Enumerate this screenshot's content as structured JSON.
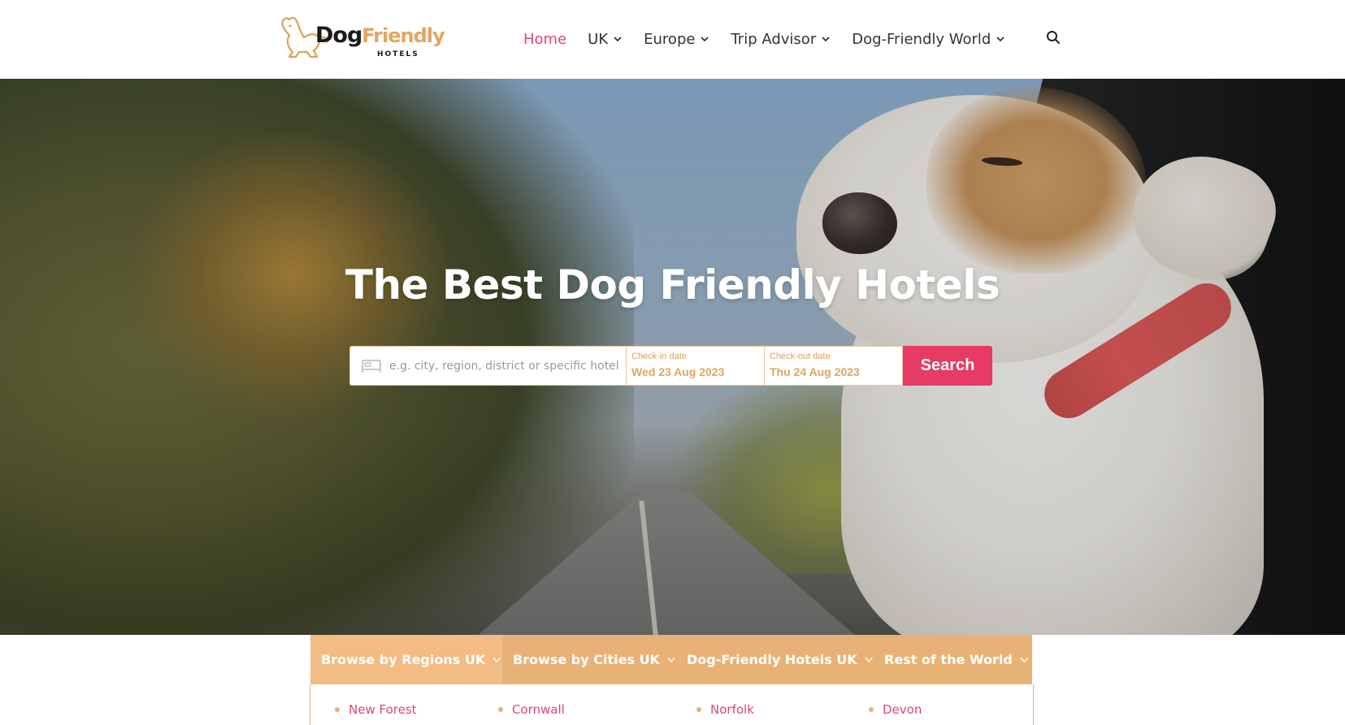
{
  "brand": {
    "logo_word_1": "Dog",
    "logo_word_2": "Friendly",
    "logo_sub": "HOTELS",
    "colors": {
      "accent": "#e2456e",
      "gold": "#e8b277",
      "button": "#e63b64"
    }
  },
  "nav": {
    "items": [
      {
        "label": "Home",
        "active": true
      },
      {
        "label": "UK",
        "dropdown": true
      },
      {
        "label": "Europe",
        "dropdown": true
      },
      {
        "label": "Trip Advisor",
        "dropdown": true
      },
      {
        "label": "Dog-Friendly World",
        "dropdown": true
      }
    ],
    "search_icon": "search-icon"
  },
  "hero": {
    "title": "The Best Dog Friendly Hotels",
    "search": {
      "destination_placeholder": "e.g. city, region, district or specific hotel",
      "checkin_label": "Check-in date",
      "checkin_value": "Wed 23 Aug 2023",
      "checkout_label": "Check-out date",
      "checkout_value": "Thu 24 Aug 2023",
      "button_label": "Search"
    }
  },
  "browse": {
    "tabs": [
      {
        "label": "Browse by Regions UK",
        "active": true
      },
      {
        "label": "Browse by Cities UK"
      },
      {
        "label": "Dog-Friendly Hotels UK"
      },
      {
        "label": "Rest of the World"
      }
    ],
    "items": [
      "New Forest",
      "Cornwall",
      "Norfolk",
      "Devon"
    ]
  }
}
